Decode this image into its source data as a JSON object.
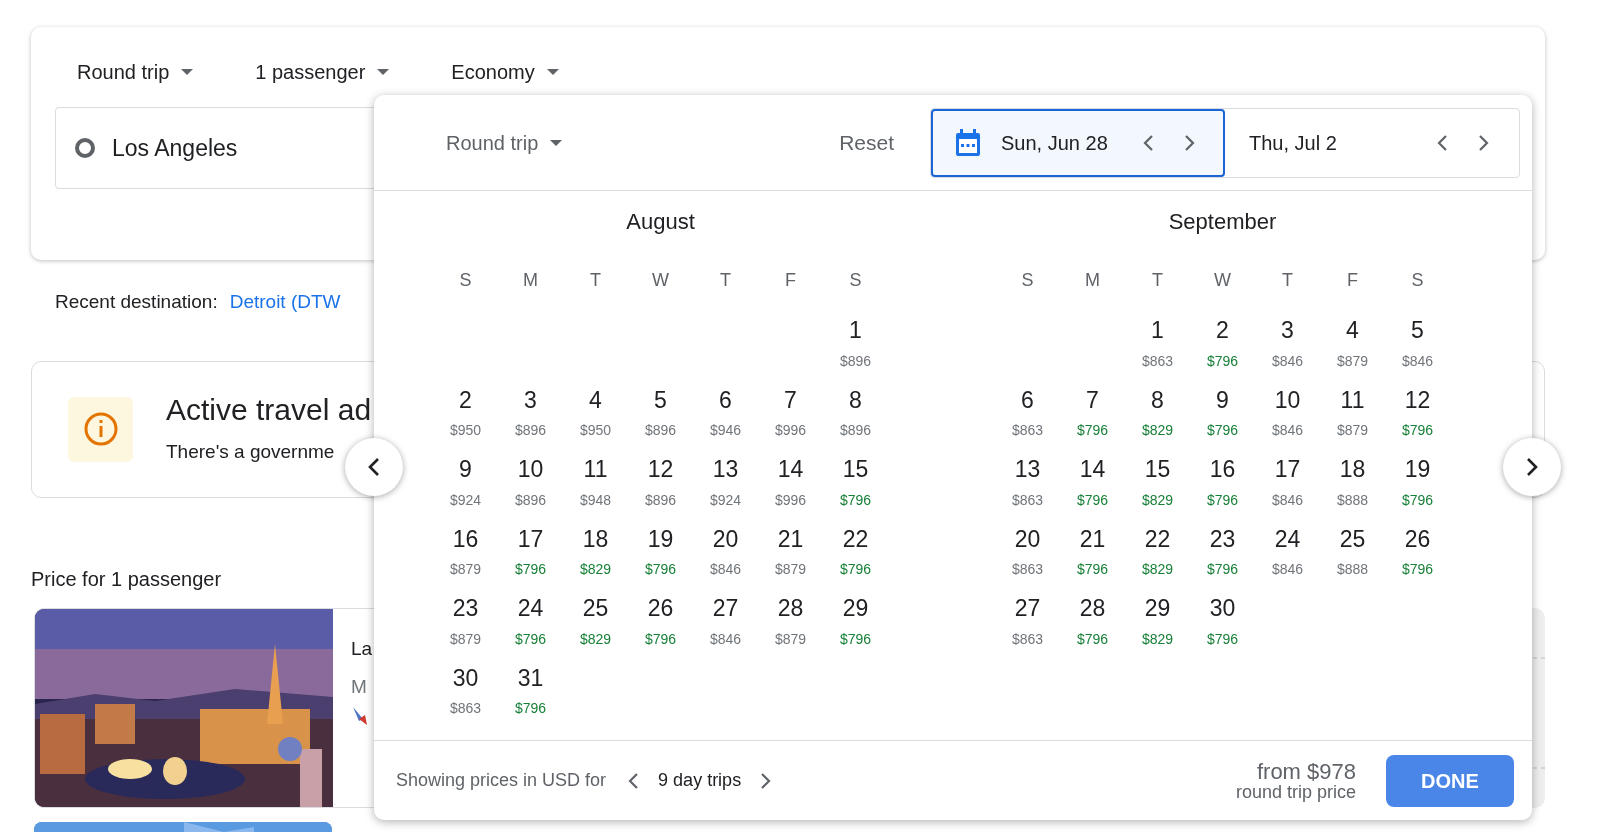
{
  "search": {
    "trip_type": "Round trip",
    "passengers": "1 passenger",
    "cabin": "Economy",
    "origin": "Los Angeles"
  },
  "recent": {
    "label": "Recent destination:",
    "link": "Detroit (DTW"
  },
  "advisory": {
    "title": "Active travel ad",
    "text": "There's a governme"
  },
  "price_heading": "Price for 1 passenger",
  "result": {
    "title": "La",
    "subtitle": "M"
  },
  "picker": {
    "trip_type": "Round trip",
    "reset": "Reset",
    "dates": [
      {
        "label": "Sun, Jun 28",
        "selected": true
      },
      {
        "label": "Thu, Jul 2",
        "selected": false
      }
    ],
    "months": [
      {
        "name": "August",
        "weekdays": [
          "S",
          "M",
          "T",
          "W",
          "T",
          "F",
          "S"
        ],
        "weeks": [
          {
            "flush_right": true,
            "days": [
              {
                "day": "1",
                "price": "$896",
                "cheap": false
              }
            ]
          },
          [
            {
              "day": "2",
              "price": "$950",
              "cheap": false
            },
            {
              "day": "3",
              "price": "$896",
              "cheap": false
            },
            {
              "day": "4",
              "price": "$950",
              "cheap": false
            },
            {
              "day": "5",
              "price": "$896",
              "cheap": false
            },
            {
              "day": "6",
              "price": "$946",
              "cheap": false
            },
            {
              "day": "7",
              "price": "$996",
              "cheap": false
            },
            {
              "day": "8",
              "price": "$896",
              "cheap": false
            }
          ],
          [
            {
              "day": "9",
              "price": "$924",
              "cheap": false
            },
            {
              "day": "10",
              "price": "$896",
              "cheap": false
            },
            {
              "day": "11",
              "price": "$948",
              "cheap": false
            },
            {
              "day": "12",
              "price": "$896",
              "cheap": false
            },
            {
              "day": "13",
              "price": "$924",
              "cheap": false
            },
            {
              "day": "14",
              "price": "$996",
              "cheap": false
            },
            {
              "day": "15",
              "price": "$796",
              "cheap": true
            }
          ],
          [
            {
              "day": "16",
              "price": "$879",
              "cheap": false
            },
            {
              "day": "17",
              "price": "$796",
              "cheap": true
            },
            {
              "day": "18",
              "price": "$829",
              "cheap": true
            },
            {
              "day": "19",
              "price": "$796",
              "cheap": true
            },
            {
              "day": "20",
              "price": "$846",
              "cheap": false
            },
            {
              "day": "21",
              "price": "$879",
              "cheap": false
            },
            {
              "day": "22",
              "price": "$796",
              "cheap": true
            }
          ],
          [
            {
              "day": "23",
              "price": "$879",
              "cheap": false
            },
            {
              "day": "24",
              "price": "$796",
              "cheap": true
            },
            {
              "day": "25",
              "price": "$829",
              "cheap": true
            },
            {
              "day": "26",
              "price": "$796",
              "cheap": true
            },
            {
              "day": "27",
              "price": "$846",
              "cheap": false
            },
            {
              "day": "28",
              "price": "$879",
              "cheap": false
            },
            {
              "day": "29",
              "price": "$796",
              "cheap": true
            }
          ],
          [
            {
              "day": "30",
              "price": "$863",
              "cheap": false
            },
            {
              "day": "31",
              "price": "$796",
              "cheap": true
            }
          ]
        ]
      },
      {
        "name": "September",
        "weekdays": [
          "S",
          "M",
          "T",
          "W",
          "T",
          "F",
          "S"
        ],
        "weeks": [
          {
            "flush_right": true,
            "days": [
              {
                "day": "1",
                "price": "$863",
                "cheap": false
              },
              {
                "day": "2",
                "price": "$796",
                "cheap": true
              },
              {
                "day": "3",
                "price": "$846",
                "cheap": false
              },
              {
                "day": "4",
                "price": "$879",
                "cheap": false
              },
              {
                "day": "5",
                "price": "$846",
                "cheap": false
              }
            ]
          },
          [
            {
              "day": "6",
              "price": "$863",
              "cheap": false
            },
            {
              "day": "7",
              "price": "$796",
              "cheap": true
            },
            {
              "day": "8",
              "price": "$829",
              "cheap": true
            },
            {
              "day": "9",
              "price": "$796",
              "cheap": true
            },
            {
              "day": "10",
              "price": "$846",
              "cheap": false
            },
            {
              "day": "11",
              "price": "$879",
              "cheap": false
            },
            {
              "day": "12",
              "price": "$796",
              "cheap": true
            }
          ],
          [
            {
              "day": "13",
              "price": "$863",
              "cheap": false
            },
            {
              "day": "14",
              "price": "$796",
              "cheap": true
            },
            {
              "day": "15",
              "price": "$829",
              "cheap": true
            },
            {
              "day": "16",
              "price": "$796",
              "cheap": true
            },
            {
              "day": "17",
              "price": "$846",
              "cheap": false
            },
            {
              "day": "18",
              "price": "$888",
              "cheap": false
            },
            {
              "day": "19",
              "price": "$796",
              "cheap": true
            }
          ],
          [
            {
              "day": "20",
              "price": "$863",
              "cheap": false
            },
            {
              "day": "21",
              "price": "$796",
              "cheap": true
            },
            {
              "day": "22",
              "price": "$829",
              "cheap": true
            },
            {
              "day": "23",
              "price": "$796",
              "cheap": true
            },
            {
              "day": "24",
              "price": "$846",
              "cheap": false
            },
            {
              "day": "25",
              "price": "$888",
              "cheap": false
            },
            {
              "day": "26",
              "price": "$796",
              "cheap": true
            }
          ],
          [
            {
              "day": "27",
              "price": "$863",
              "cheap": false
            },
            {
              "day": "28",
              "price": "$796",
              "cheap": true
            },
            {
              "day": "29",
              "price": "$829",
              "cheap": true
            },
            {
              "day": "30",
              "price": "$796",
              "cheap": true
            }
          ]
        ]
      }
    ],
    "footer": {
      "label": "Showing prices in USD for",
      "duration": "9 day trips",
      "price": "from $978",
      "price_note": "round trip price",
      "done": "DONE"
    }
  }
}
